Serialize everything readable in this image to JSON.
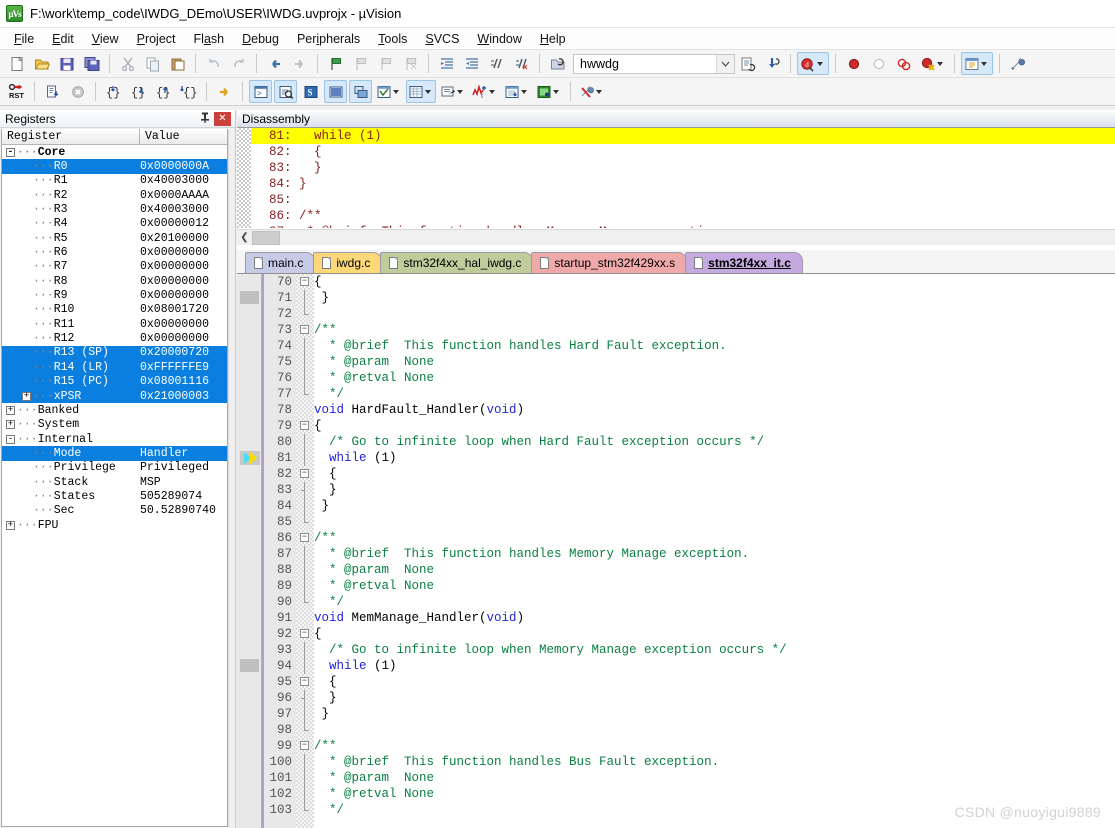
{
  "window": {
    "title": "F:\\work\\temp_code\\IWDG_DEmo\\USER\\IWDG.uvprojx - µVision",
    "app_icon": "uvision-icon",
    "icon_glyph": "µVs"
  },
  "menu": {
    "items": [
      {
        "label": "File",
        "accel": "F"
      },
      {
        "label": "Edit",
        "accel": "E"
      },
      {
        "label": "View",
        "accel": "V"
      },
      {
        "label": "Project",
        "accel": "P"
      },
      {
        "label": "Flash",
        "accel": "a"
      },
      {
        "label": "Debug",
        "accel": "D"
      },
      {
        "label": "Peripherals",
        "accel": "i"
      },
      {
        "label": "Tools",
        "accel": "T"
      },
      {
        "label": "SVCS",
        "accel": "S"
      },
      {
        "label": "Window",
        "accel": "W"
      },
      {
        "label": "Help",
        "accel": "H"
      }
    ]
  },
  "toolbar_main": {
    "buttons": [
      "new-file-icon",
      "open-file-icon",
      "save-icon",
      "save-all-icon",
      "cut-icon",
      "copy-icon",
      "paste-icon",
      "undo-icon",
      "redo-icon",
      "navigate-back-icon",
      "navigate-forward-icon",
      "bookmark-toggle-icon",
      "bookmark-prev-icon",
      "bookmark-next-icon",
      "bookmark-clear-icon",
      "indent-icon",
      "outdent-icon",
      "comment-icon",
      "uncomment-icon"
    ],
    "target_combo": {
      "value": "hwwdg",
      "icon": "target-options-icon",
      "dropdown_icon": "chevron-down-icon"
    },
    "after_combo": [
      "target-options-icon",
      "manage-components-icon",
      "start-stop-debug-icon",
      "breakpoint-insert-icon",
      "breakpoint-disable-icon",
      "breakpoint-disable-all-icon",
      "breakpoint-kill-all-icon",
      "window-layout-icon",
      "configure-icon"
    ]
  },
  "toolbar_debug": {
    "buttons": [
      "reset-cpu-icon",
      "run-icon",
      "stop-icon",
      "step-into-icon",
      "step-over-icon",
      "step-out-icon",
      "run-to-cursor-icon",
      "show-next-statement-icon",
      "command-window-icon",
      "disassembly-window-icon",
      "symbols-window-icon",
      "registers-window-icon",
      "call-stack-window-icon",
      "watch-window-icon",
      "memory-window-icon",
      "serial-window-icon",
      "analysis-window-icon",
      "trace-window-icon",
      "system-viewer-icon",
      "toolbox-icon"
    ]
  },
  "registers_panel": {
    "title": "Registers",
    "pin_icon": "pin-icon",
    "close_icon": "close-icon",
    "columns": [
      "Register",
      "Value"
    ],
    "rows": [
      {
        "depth": 0,
        "toggle": "-",
        "name": "Core",
        "value": "",
        "selected": false,
        "bold": true
      },
      {
        "depth": 1,
        "toggle": "",
        "name": "R0",
        "value": "0x0000000A",
        "selected": true,
        "bold": false
      },
      {
        "depth": 1,
        "toggle": "",
        "name": "R1",
        "value": "0x40003000",
        "selected": false,
        "bold": false
      },
      {
        "depth": 1,
        "toggle": "",
        "name": "R2",
        "value": "0x0000AAAA",
        "selected": false,
        "bold": false
      },
      {
        "depth": 1,
        "toggle": "",
        "name": "R3",
        "value": "0x40003000",
        "selected": false,
        "bold": false
      },
      {
        "depth": 1,
        "toggle": "",
        "name": "R4",
        "value": "0x00000012",
        "selected": false,
        "bold": false
      },
      {
        "depth": 1,
        "toggle": "",
        "name": "R5",
        "value": "0x20100000",
        "selected": false,
        "bold": false
      },
      {
        "depth": 1,
        "toggle": "",
        "name": "R6",
        "value": "0x00000000",
        "selected": false,
        "bold": false
      },
      {
        "depth": 1,
        "toggle": "",
        "name": "R7",
        "value": "0x00000000",
        "selected": false,
        "bold": false
      },
      {
        "depth": 1,
        "toggle": "",
        "name": "R8",
        "value": "0x00000000",
        "selected": false,
        "bold": false
      },
      {
        "depth": 1,
        "toggle": "",
        "name": "R9",
        "value": "0x00000000",
        "selected": false,
        "bold": false
      },
      {
        "depth": 1,
        "toggle": "",
        "name": "R10",
        "value": "0x08001720",
        "selected": false,
        "bold": false
      },
      {
        "depth": 1,
        "toggle": "",
        "name": "R11",
        "value": "0x00000000",
        "selected": false,
        "bold": false
      },
      {
        "depth": 1,
        "toggle": "",
        "name": "R12",
        "value": "0x00000000",
        "selected": false,
        "bold": false
      },
      {
        "depth": 1,
        "toggle": "",
        "name": "R13 (SP)",
        "value": "0x20000720",
        "selected": true,
        "bold": false
      },
      {
        "depth": 1,
        "toggle": "",
        "name": "R14 (LR)",
        "value": "0xFFFFFFE9",
        "selected": true,
        "bold": false
      },
      {
        "depth": 1,
        "toggle": "",
        "name": "R15 (PC)",
        "value": "0x08001116",
        "selected": true,
        "bold": false
      },
      {
        "depth": 1,
        "toggle": "+",
        "name": "xPSR",
        "value": "0x21000003",
        "selected": true,
        "bold": false
      },
      {
        "depth": 0,
        "toggle": "+",
        "name": "Banked",
        "value": "",
        "selected": false,
        "bold": false
      },
      {
        "depth": 0,
        "toggle": "+",
        "name": "System",
        "value": "",
        "selected": false,
        "bold": false
      },
      {
        "depth": 0,
        "toggle": "-",
        "name": "Internal",
        "value": "",
        "selected": false,
        "bold": false
      },
      {
        "depth": 1,
        "toggle": "",
        "name": "Mode",
        "value": "Handler",
        "selected": true,
        "bold": false
      },
      {
        "depth": 1,
        "toggle": "",
        "name": "Privilege",
        "value": "Privileged",
        "selected": false,
        "bold": false
      },
      {
        "depth": 1,
        "toggle": "",
        "name": "Stack",
        "value": "MSP",
        "selected": false,
        "bold": false
      },
      {
        "depth": 1,
        "toggle": "",
        "name": "States",
        "value": "505289074",
        "selected": false,
        "bold": false
      },
      {
        "depth": 1,
        "toggle": "",
        "name": "Sec",
        "value": "50.52890740",
        "selected": false,
        "bold": false
      },
      {
        "depth": 0,
        "toggle": "+",
        "name": "FPU",
        "value": "",
        "selected": false,
        "bold": false
      }
    ]
  },
  "disassembly_panel": {
    "title": "Disassembly",
    "scroll_left_icon": "chevron-left-icon",
    "lines": [
      {
        "num": "81:",
        "text": "   while (1)",
        "highlight": true
      },
      {
        "num": "82:",
        "text": "   {",
        "highlight": false
      },
      {
        "num": "83:",
        "text": "   }",
        "highlight": false
      },
      {
        "num": "84:",
        "text": " }",
        "highlight": false
      },
      {
        "num": "85:",
        "text": "",
        "highlight": false
      },
      {
        "num": "86:",
        "text": " /**",
        "highlight": false
      },
      {
        "num": "87:",
        "text": "  * @brief  This function handles Memory Manage exception.",
        "highlight": false
      }
    ]
  },
  "editor_tabs": [
    {
      "label": "main.c",
      "color": "#c6cbe8",
      "active": false,
      "icon": "file-icon"
    },
    {
      "label": "iwdg.c",
      "color": "#fcd878",
      "active": false,
      "icon": "file-icon"
    },
    {
      "label": "stm32f4xx_hal_iwdg.c",
      "color": "#c0cc9b",
      "active": false,
      "icon": "file-icon"
    },
    {
      "label": "startup_stm32f429xx.s",
      "color": "#f0a9a9",
      "active": false,
      "icon": "file-icon"
    },
    {
      "label": "stm32f4xx_it.c",
      "color": "#c4aadf",
      "active": true,
      "icon": "file-icon"
    }
  ],
  "editor": {
    "active_file": "stm32f4xx_it.c",
    "pc_line": 81,
    "pc_marker": "execution-pointer-icon",
    "lines": [
      {
        "num": 70,
        "fold": "open",
        "tokens": [
          {
            "t": "{",
            "c": "pp"
          }
        ]
      },
      {
        "num": 71,
        "fold": "bar",
        "tokens": [
          {
            "t": " }",
            "c": "pp"
          }
        ]
      },
      {
        "num": 72,
        "fold": "end",
        "tokens": []
      },
      {
        "num": 73,
        "fold": "open",
        "tokens": [
          {
            "t": "/**",
            "c": "cm"
          }
        ]
      },
      {
        "num": 74,
        "fold": "bar",
        "tokens": [
          {
            "t": "  * @brief  This function handles Hard Fault exception.",
            "c": "cm"
          }
        ]
      },
      {
        "num": 75,
        "fold": "bar",
        "tokens": [
          {
            "t": "  * @param  None",
            "c": "cm"
          }
        ]
      },
      {
        "num": 76,
        "fold": "bar",
        "tokens": [
          {
            "t": "  * @retval None",
            "c": "cm"
          }
        ]
      },
      {
        "num": 77,
        "fold": "end",
        "tokens": [
          {
            "t": "  */",
            "c": "cm"
          }
        ]
      },
      {
        "num": 78,
        "fold": "none",
        "tokens": [
          {
            "t": "void",
            "c": "kw"
          },
          {
            "t": " HardFault_Handler(",
            "c": "pp"
          },
          {
            "t": "void",
            "c": "kw"
          },
          {
            "t": ")",
            "c": "pp"
          }
        ]
      },
      {
        "num": 79,
        "fold": "open",
        "tokens": [
          {
            "t": "{",
            "c": "pp"
          }
        ]
      },
      {
        "num": 80,
        "fold": "bar",
        "tokens": [
          {
            "t": "  /* Go to infinite loop when Hard Fault exception occurs */",
            "c": "cm"
          }
        ]
      },
      {
        "num": 81,
        "fold": "bar",
        "tokens": [
          {
            "t": "  ",
            "c": "pp"
          },
          {
            "t": "while",
            "c": "kw"
          },
          {
            "t": " (1)",
            "c": "pp"
          }
        ]
      },
      {
        "num": 82,
        "fold": "open",
        "tokens": [
          {
            "t": "  {",
            "c": "pp"
          }
        ]
      },
      {
        "num": 83,
        "fold": "tick",
        "tokens": [
          {
            "t": "  }",
            "c": "pp"
          }
        ]
      },
      {
        "num": 84,
        "fold": "bar",
        "tokens": [
          {
            "t": " }",
            "c": "pp"
          }
        ]
      },
      {
        "num": 85,
        "fold": "end",
        "tokens": []
      },
      {
        "num": 86,
        "fold": "open",
        "tokens": [
          {
            "t": "/**",
            "c": "cm"
          }
        ]
      },
      {
        "num": 87,
        "fold": "bar",
        "tokens": [
          {
            "t": "  * @brief  This function handles Memory Manage exception.",
            "c": "cm"
          }
        ]
      },
      {
        "num": 88,
        "fold": "bar",
        "tokens": [
          {
            "t": "  * @param  None",
            "c": "cm"
          }
        ]
      },
      {
        "num": 89,
        "fold": "bar",
        "tokens": [
          {
            "t": "  * @retval None",
            "c": "cm"
          }
        ]
      },
      {
        "num": 90,
        "fold": "end",
        "tokens": [
          {
            "t": "  */",
            "c": "cm"
          }
        ]
      },
      {
        "num": 91,
        "fold": "none",
        "tokens": [
          {
            "t": "void",
            "c": "kw"
          },
          {
            "t": " MemManage_Handler(",
            "c": "pp"
          },
          {
            "t": "void",
            "c": "kw"
          },
          {
            "t": ")",
            "c": "pp"
          }
        ]
      },
      {
        "num": 92,
        "fold": "open",
        "tokens": [
          {
            "t": "{",
            "c": "pp"
          }
        ]
      },
      {
        "num": 93,
        "fold": "bar",
        "tokens": [
          {
            "t": "  /* Go to infinite loop when Memory Manage exception occurs */",
            "c": "cm"
          }
        ]
      },
      {
        "num": 94,
        "fold": "bar",
        "tokens": [
          {
            "t": "  ",
            "c": "pp"
          },
          {
            "t": "while",
            "c": "kw"
          },
          {
            "t": " (1)",
            "c": "pp"
          }
        ]
      },
      {
        "num": 95,
        "fold": "open",
        "tokens": [
          {
            "t": "  {",
            "c": "pp"
          }
        ]
      },
      {
        "num": 96,
        "fold": "tick",
        "tokens": [
          {
            "t": "  }",
            "c": "pp"
          }
        ]
      },
      {
        "num": 97,
        "fold": "bar",
        "tokens": [
          {
            "t": " }",
            "c": "pp"
          }
        ]
      },
      {
        "num": 98,
        "fold": "end",
        "tokens": []
      },
      {
        "num": 99,
        "fold": "open",
        "tokens": [
          {
            "t": "/**",
            "c": "cm"
          }
        ]
      },
      {
        "num": 100,
        "fold": "bar",
        "tokens": [
          {
            "t": "  * @brief  This function handles Bus Fault exception.",
            "c": "cm"
          }
        ]
      },
      {
        "num": 101,
        "fold": "bar",
        "tokens": [
          {
            "t": "  * @param  None",
            "c": "cm"
          }
        ]
      },
      {
        "num": 102,
        "fold": "bar",
        "tokens": [
          {
            "t": "  * @retval None",
            "c": "cm"
          }
        ]
      },
      {
        "num": 103,
        "fold": "end",
        "tokens": [
          {
            "t": "  */",
            "c": "cm"
          }
        ]
      }
    ]
  },
  "watermark": "CSDN @nuoyigui9889",
  "colors": {
    "selection_blue": "#0a7fe0",
    "highlight_yellow": "#ffff00",
    "comment_green": "#0b8043",
    "keyword_blue": "#2323dd",
    "disasm_red": "#8a2020"
  }
}
